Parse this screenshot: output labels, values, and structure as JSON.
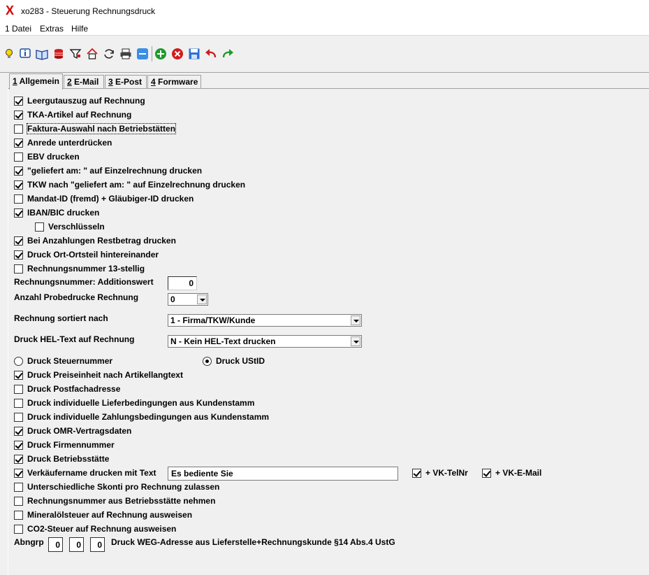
{
  "window": {
    "app_icon": "X",
    "title": "xo283 - Steuerung Rechnungsdruck"
  },
  "menu": [
    "1 Datei",
    "Extras",
    "Hilfe"
  ],
  "toolbar": {
    "icons": [
      "lightbulb-icon",
      "info-icon",
      "book-icon",
      "database-icon",
      "filter-icon",
      "home-icon",
      "refresh-icon",
      "printer-icon",
      "minus-icon",
      "add-icon",
      "delete-icon",
      "save-icon",
      "undo-icon",
      "redo-icon"
    ]
  },
  "tabs": [
    {
      "key": "1",
      "label": " Allgemein"
    },
    {
      "key": "2",
      "label": " E-Mail"
    },
    {
      "key": "3",
      "label": " E-Post"
    },
    {
      "key": "4",
      "label": " Formware"
    }
  ],
  "options": {
    "leergut": {
      "label": "Leergutauszug auf Rechnung",
      "checked": true
    },
    "tka": {
      "label": "TKA-Artikel auf Rechnung",
      "checked": true
    },
    "faktura": {
      "label": "Faktura-Auswahl nach Betriebstätten",
      "checked": false
    },
    "anrede": {
      "label": "Anrede unterdrücken",
      "checked": true
    },
    "ebv": {
      "label": "EBV drucken",
      "checked": false
    },
    "geliefert": {
      "label": "\"geliefert am: \" auf Einzelrechnung drucken",
      "checked": true
    },
    "tkw": {
      "label": "TKW nach \"geliefert am: \" auf Einzelrechnung drucken",
      "checked": true
    },
    "mandat": {
      "label": "Mandat-ID (fremd) + Gläubiger-ID drucken",
      "checked": false
    },
    "iban": {
      "label": "IBAN/BIC drucken",
      "checked": true
    },
    "verschluesseln": {
      "label": "Verschlüsseln",
      "checked": false
    },
    "anzahlungen": {
      "label": "Bei Anzahlungen Restbetrag drucken",
      "checked": true
    },
    "ortsteil": {
      "label": "Druck Ort-Ortsteil hintereinander",
      "checked": true
    },
    "nr13": {
      "label": "Rechnungsnummer 13-stellig",
      "checked": false
    },
    "preiseinheit": {
      "label": "Druck Preiseinheit nach Artikellangtext",
      "checked": true
    },
    "postfach": {
      "label": "Druck Postfachadresse",
      "checked": false
    },
    "lieferbed": {
      "label": "Druck individuelle Lieferbedingungen aus Kundenstamm",
      "checked": false
    },
    "zahlungsbed": {
      "label": "Druck individuelle Zahlungsbedingungen aus Kundenstamm",
      "checked": false
    },
    "omr": {
      "label": "Druck OMR-Vertragsdaten",
      "checked": true
    },
    "firmennr": {
      "label": "Druck Firmennummer",
      "checked": true
    },
    "betriebsstaette": {
      "label": "Druck Betriebsstätte",
      "checked": true
    },
    "verkaeufer": {
      "label": "Verkäufername drucken mit Text",
      "checked": true
    },
    "vk_telnr": {
      "label": "+ VK-TelNr",
      "checked": true
    },
    "vk_email": {
      "label": "+ VK-E-Mail",
      "checked": true
    },
    "skonti": {
      "label": "Unterschiedliche Skonti pro Rechnung zulassen",
      "checked": false
    },
    "rechnr_bst": {
      "label": "Rechnungsnummer aus Betriebsstätte nehmen",
      "checked": false
    },
    "mineraloel": {
      "label": "Mineralölsteuer auf Rechnung ausweisen",
      "checked": false
    },
    "co2": {
      "label": "CO2-Steuer auf Rechnung ausweisen",
      "checked": false
    }
  },
  "fields": {
    "additionswert": {
      "label": "Rechnungsnummer: Additionswert",
      "value": "0"
    },
    "probedrucke": {
      "label": "Anzahl Probedrucke Rechnung",
      "value": "0"
    },
    "sortiert": {
      "label": "Rechnung sortiert nach",
      "value": "1 - Firma/TKW/Kunde"
    },
    "heltext": {
      "label": "Druck HEL-Text auf Rechnung",
      "value": "N - Kein HEL-Text drucken"
    },
    "verkaeufer_text": "Es bediente Sie"
  },
  "radios": {
    "steuernummer": {
      "label": "Druck Steuernummer",
      "checked": false
    },
    "ustid": {
      "label": "Druck UStID",
      "checked": true
    }
  },
  "abngrp": {
    "label": "Abngrp",
    "values": [
      "0",
      "0",
      "0"
    ],
    "trailing_label": "Druck WEG-Adresse aus Lieferstelle+Rechnungskunde §14 Abs.4 UstG"
  }
}
